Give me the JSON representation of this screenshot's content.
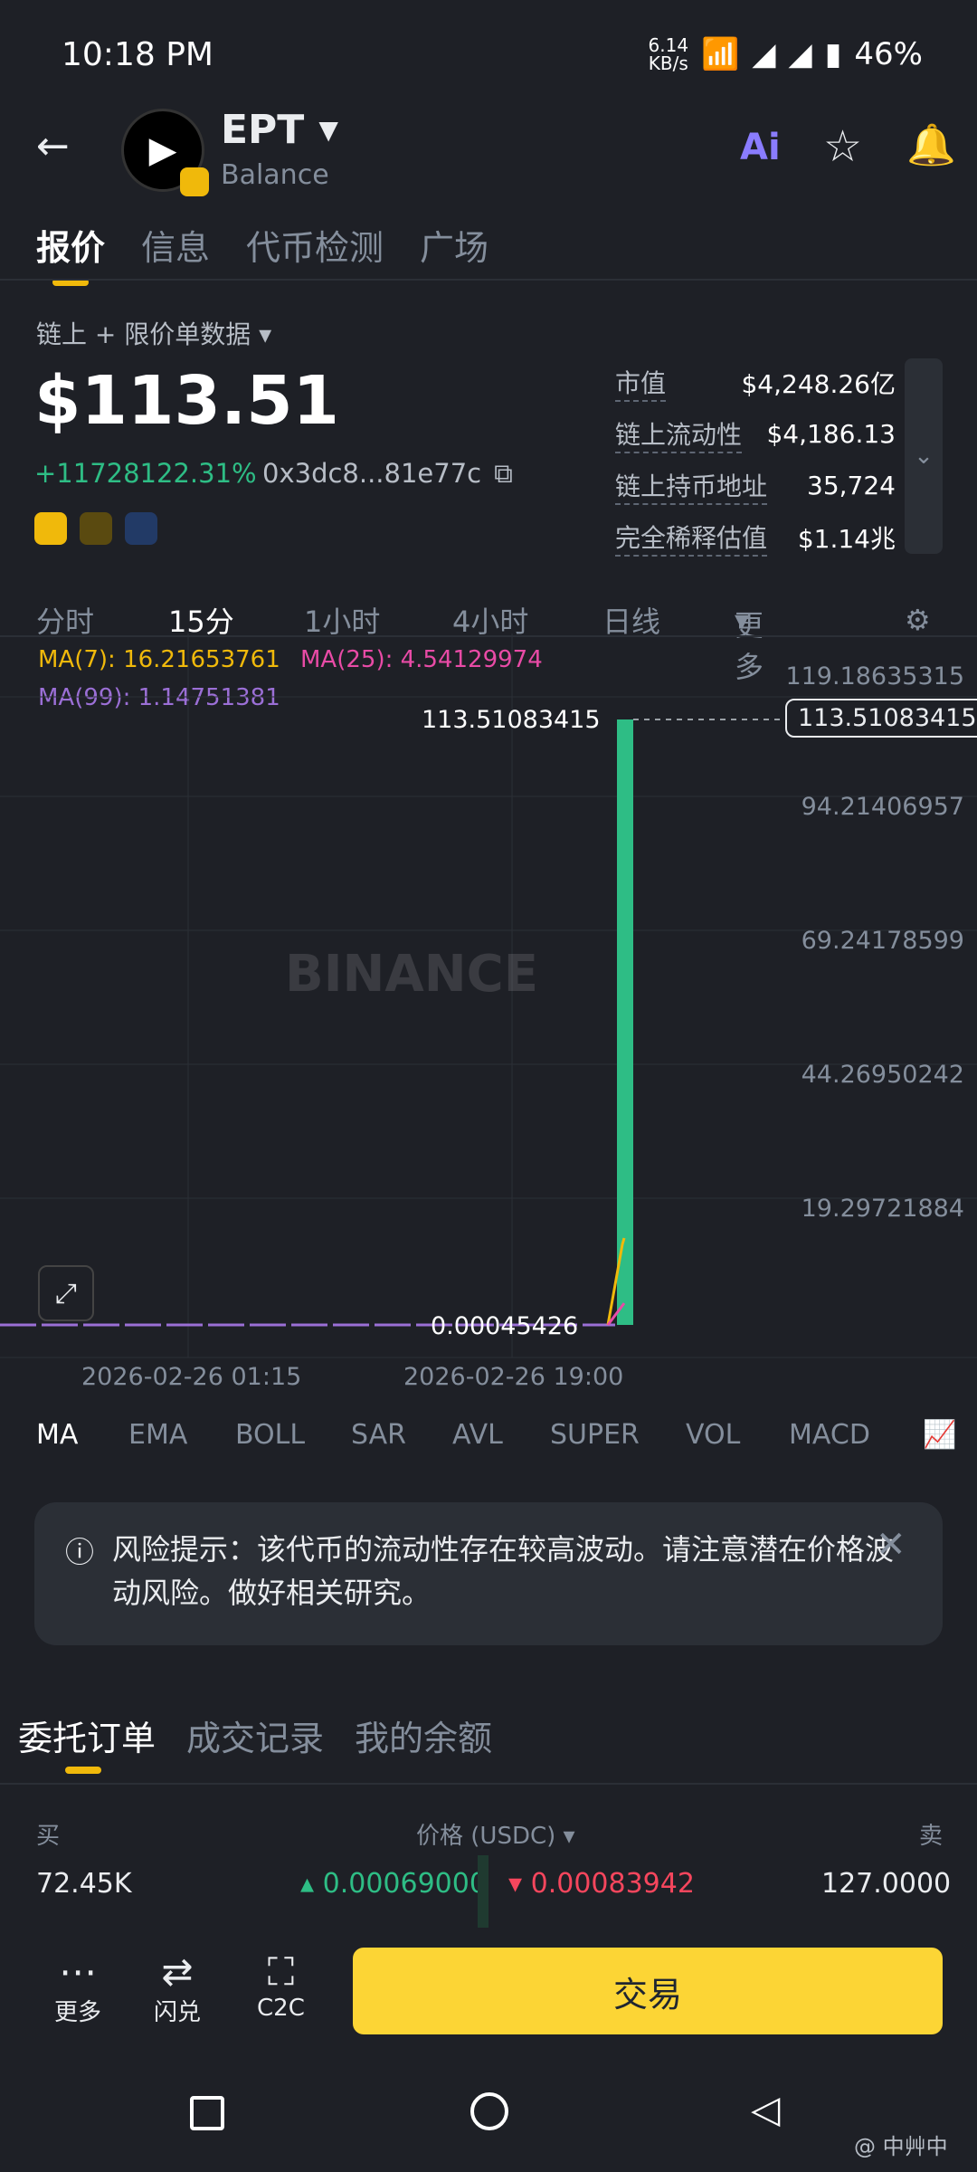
{
  "status_bar": {
    "time": "10:18 PM",
    "net_speed": "6.14",
    "net_unit": "KB/s",
    "battery": "46%"
  },
  "header": {
    "symbol": "EPT",
    "subtitle": "Balance",
    "ai_label": "Ai"
  },
  "tabs": [
    "报价",
    "信息",
    "代币检测",
    "广场"
  ],
  "data_source": "链上 + 限价单数据",
  "price": "$113.51",
  "change": "+11728122.31%",
  "contract": "0x3dc8...81e77c",
  "stats": [
    {
      "k": "市值",
      "v": "$4,248.26亿"
    },
    {
      "k": "链上流动性",
      "v": "$4,186.13"
    },
    {
      "k": "链上持币地址",
      "v": "35,724"
    },
    {
      "k": "完全稀释估值",
      "v": "$1.14兆"
    }
  ],
  "timeframes": [
    "分时",
    "15分",
    "1小时",
    "4小时",
    "日线",
    "更多"
  ],
  "ma": {
    "ma7": "MA(7): 16.21653761",
    "ma25": "MA(25): 4.54129974",
    "ma99": "MA(99): 1.14751381"
  },
  "chart_data": {
    "type": "bar",
    "y_ticks": [
      "119.18635315",
      "94.21406957",
      "69.24178599",
      "44.26950242",
      "19.29721884"
    ],
    "x_ticks": [
      "2026-02-26 01:15",
      "2026-02-26 19:00"
    ],
    "current_price_label": "113.51083415",
    "high_label": "113.51083415",
    "low_label": "0.00045426",
    "ylim": [
      0,
      119.18635315
    ],
    "last_candle": {
      "open": 0.00045426,
      "close": 113.51083415
    }
  },
  "watermark": "BINANCE",
  "indicators": [
    "MA",
    "EMA",
    "BOLL",
    "SAR",
    "AVL",
    "SUPER",
    "VOL",
    "MACD"
  ],
  "risk": {
    "text": "风险提示：该代币的流动性存在较高波动。请注意潜在价格波动风险。做好相关研究。"
  },
  "order_tabs": [
    "委托订单",
    "成交记录",
    "我的余额"
  ],
  "orderbook": {
    "buy_label": "买",
    "price_label": "价格 (USDC)",
    "sell_label": "卖",
    "rows": [
      {
        "buy_qty": "72.45K",
        "bid": "0.00069000",
        "ask": "0.00083942",
        "sell_qty": "127.0000"
      }
    ]
  },
  "bottom_bar": {
    "more": "更多",
    "convert": "闪兑",
    "c2c": "C2C",
    "trade": "交易"
  },
  "nav": {
    "watermark_text": "@ 中艸中"
  }
}
